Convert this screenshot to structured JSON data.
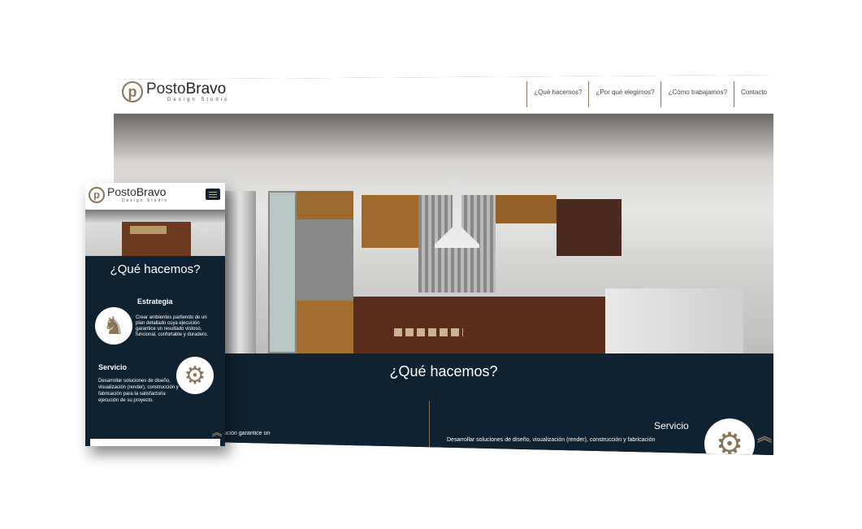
{
  "brand": {
    "name_a": "Posto",
    "name_b": "Bravo",
    "tagline": "Design Studio",
    "mark": "p"
  },
  "nav": [
    "¿Qué hacemos?",
    "¿Por qué elegirnos?",
    "¿Cómo trabajamos?",
    "Contacto"
  ],
  "section": {
    "title": "¿Qué hacemos?",
    "strategy": {
      "title": "Estrategia",
      "text": "Crear ambientes partiendo de un plan detallado cuya ejecución garantice un resultado vistoso, funcional, confortable y duradero.",
      "desk_fragment": "es partiendo de un plan detallado cuya ejecución garantice un"
    },
    "service": {
      "title": "Servicio",
      "text": "Desarrollar soluciones de diseño, visualización (render), construcción y fabricación para la satisfactoria ejecución de su proyecto.",
      "desk_fragment": "Desarrollar soluciones de diseño, visualización (render), construcción y fabricación"
    }
  },
  "icons": {
    "strategy": "♞",
    "service": "⚙",
    "scroll_top": "︽"
  },
  "colors": {
    "navy": "#0e2232",
    "gold": "#8a7558"
  }
}
